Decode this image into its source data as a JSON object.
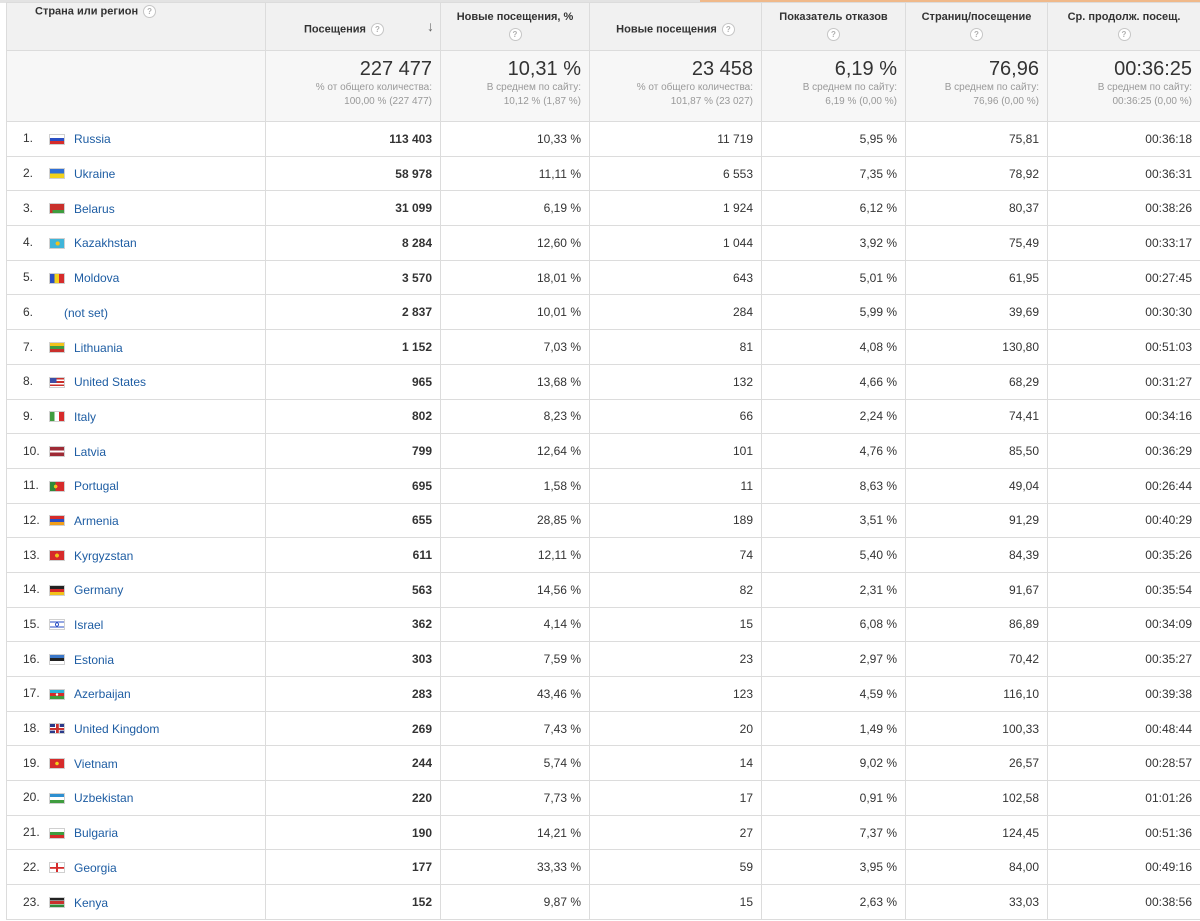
{
  "columns": [
    {
      "label": "Страна или регион",
      "help": "?"
    },
    {
      "label": "Посещения",
      "help": "?",
      "sort": "↓"
    },
    {
      "label": "Новые посещения, %",
      "help": "?"
    },
    {
      "label": "Новые посещения",
      "help": "?"
    },
    {
      "label": "Показатель отказов",
      "help": "?"
    },
    {
      "label": "Страниц/посещение",
      "help": "?"
    },
    {
      "label": "Ср. продолж. посещ.",
      "help": "?"
    }
  ],
  "totals": [
    {
      "value": "227 477",
      "sub1": "% от общего количества:",
      "sub2": "100,00 % (227 477)"
    },
    {
      "value": "10,31 %",
      "sub1": "В среднем по сайту:",
      "sub2": "10,12 % (1,87 %)"
    },
    {
      "value": "23 458",
      "sub1": "% от общего количества:",
      "sub2": "101,87 % (23 027)"
    },
    {
      "value": "6,19 %",
      "sub1": "В среднем по сайту:",
      "sub2": "6,19 % (0,00 %)"
    },
    {
      "value": "76,96",
      "sub1": "В среднем по сайту:",
      "sub2": "76,96 (0,00 %)"
    },
    {
      "value": "00:36:25",
      "sub1": "В среднем по сайту:",
      "sub2": "00:36:25 (0,00 %)"
    }
  ],
  "rows": [
    {
      "rank": "1.",
      "country": "Russia",
      "flag": "russia-flag-icon",
      "visits": "113 403",
      "new_pct": "10,33 %",
      "new_visits": "11 719",
      "bounce": "5,95 %",
      "pages": "75,81",
      "duration": "00:36:18"
    },
    {
      "rank": "2.",
      "country": "Ukraine",
      "flag": "ukraine-flag-icon",
      "visits": "58 978",
      "new_pct": "11,11 %",
      "new_visits": "6 553",
      "bounce": "7,35 %",
      "pages": "78,92",
      "duration": "00:36:31"
    },
    {
      "rank": "3.",
      "country": "Belarus",
      "flag": "belarus-flag-icon",
      "visits": "31 099",
      "new_pct": "6,19 %",
      "new_visits": "1 924",
      "bounce": "6,12 %",
      "pages": "80,37",
      "duration": "00:38:26"
    },
    {
      "rank": "4.",
      "country": "Kazakhstan",
      "flag": "kazakhstan-flag-icon",
      "visits": "8 284",
      "new_pct": "12,60 %",
      "new_visits": "1 044",
      "bounce": "3,92 %",
      "pages": "75,49",
      "duration": "00:33:17"
    },
    {
      "rank": "5.",
      "country": "Moldova",
      "flag": "moldova-flag-icon",
      "visits": "3 570",
      "new_pct": "18,01 %",
      "new_visits": "643",
      "bounce": "5,01 %",
      "pages": "61,95",
      "duration": "00:27:45"
    },
    {
      "rank": "6.",
      "country": "(not set)",
      "flag": "",
      "visits": "2 837",
      "new_pct": "10,01 %",
      "new_visits": "284",
      "bounce": "5,99 %",
      "pages": "39,69",
      "duration": "00:30:30"
    },
    {
      "rank": "7.",
      "country": "Lithuania",
      "flag": "lithuania-flag-icon",
      "visits": "1 152",
      "new_pct": "7,03 %",
      "new_visits": "81",
      "bounce": "4,08 %",
      "pages": "130,80",
      "duration": "00:51:03"
    },
    {
      "rank": "8.",
      "country": "United States",
      "flag": "united-states-flag-icon",
      "visits": "965",
      "new_pct": "13,68 %",
      "new_visits": "132",
      "bounce": "4,66 %",
      "pages": "68,29",
      "duration": "00:31:27"
    },
    {
      "rank": "9.",
      "country": "Italy",
      "flag": "italy-flag-icon",
      "visits": "802",
      "new_pct": "8,23 %",
      "new_visits": "66",
      "bounce": "2,24 %",
      "pages": "74,41",
      "duration": "00:34:16"
    },
    {
      "rank": "10.",
      "country": "Latvia",
      "flag": "latvia-flag-icon",
      "visits": "799",
      "new_pct": "12,64 %",
      "new_visits": "101",
      "bounce": "4,76 %",
      "pages": "85,50",
      "duration": "00:36:29"
    },
    {
      "rank": "11.",
      "country": "Portugal",
      "flag": "portugal-flag-icon",
      "visits": "695",
      "new_pct": "1,58 %",
      "new_visits": "11",
      "bounce": "8,63 %",
      "pages": "49,04",
      "duration": "00:26:44"
    },
    {
      "rank": "12.",
      "country": "Armenia",
      "flag": "armenia-flag-icon",
      "visits": "655",
      "new_pct": "28,85 %",
      "new_visits": "189",
      "bounce": "3,51 %",
      "pages": "91,29",
      "duration": "00:40:29"
    },
    {
      "rank": "13.",
      "country": "Kyrgyzstan",
      "flag": "kyrgyzstan-flag-icon",
      "visits": "611",
      "new_pct": "12,11 %",
      "new_visits": "74",
      "bounce": "5,40 %",
      "pages": "84,39",
      "duration": "00:35:26"
    },
    {
      "rank": "14.",
      "country": "Germany",
      "flag": "germany-flag-icon",
      "visits": "563",
      "new_pct": "14,56 %",
      "new_visits": "82",
      "bounce": "2,31 %",
      "pages": "91,67",
      "duration": "00:35:54"
    },
    {
      "rank": "15.",
      "country": "Israel",
      "flag": "israel-flag-icon",
      "visits": "362",
      "new_pct": "4,14 %",
      "new_visits": "15",
      "bounce": "6,08 %",
      "pages": "86,89",
      "duration": "00:34:09"
    },
    {
      "rank": "16.",
      "country": "Estonia",
      "flag": "estonia-flag-icon",
      "visits": "303",
      "new_pct": "7,59 %",
      "new_visits": "23",
      "bounce": "2,97 %",
      "pages": "70,42",
      "duration": "00:35:27"
    },
    {
      "rank": "17.",
      "country": "Azerbaijan",
      "flag": "azerbaijan-flag-icon",
      "visits": "283",
      "new_pct": "43,46 %",
      "new_visits": "123",
      "bounce": "4,59 %",
      "pages": "116,10",
      "duration": "00:39:38"
    },
    {
      "rank": "18.",
      "country": "United Kingdom",
      "flag": "united-kingdom-flag-icon",
      "visits": "269",
      "new_pct": "7,43 %",
      "new_visits": "20",
      "bounce": "1,49 %",
      "pages": "100,33",
      "duration": "00:48:44"
    },
    {
      "rank": "19.",
      "country": "Vietnam",
      "flag": "vietnam-flag-icon",
      "visits": "244",
      "new_pct": "5,74 %",
      "new_visits": "14",
      "bounce": "9,02 %",
      "pages": "26,57",
      "duration": "00:28:57"
    },
    {
      "rank": "20.",
      "country": "Uzbekistan",
      "flag": "uzbekistan-flag-icon",
      "visits": "220",
      "new_pct": "7,73 %",
      "new_visits": "17",
      "bounce": "0,91 %",
      "pages": "102,58",
      "duration": "01:01:26"
    },
    {
      "rank": "21.",
      "country": "Bulgaria",
      "flag": "bulgaria-flag-icon",
      "visits": "190",
      "new_pct": "14,21 %",
      "new_visits": "27",
      "bounce": "7,37 %",
      "pages": "124,45",
      "duration": "00:51:36"
    },
    {
      "rank": "22.",
      "country": "Georgia",
      "flag": "georgia-flag-icon",
      "visits": "177",
      "new_pct": "33,33 %",
      "new_visits": "59",
      "bounce": "3,95 %",
      "pages": "84,00",
      "duration": "00:49:16"
    },
    {
      "rank": "23.",
      "country": "Kenya",
      "flag": "kenya-flag-icon",
      "visits": "152",
      "new_pct": "9,87 %",
      "new_visits": "15",
      "bounce": "2,63 %",
      "pages": "33,03",
      "duration": "00:38:56"
    }
  ],
  "colors": {
    "link": "#1e5da3",
    "header_bg": "#f1f1f1",
    "totals_bg": "#f7f7f7",
    "border": "#dcdcdc",
    "accent_line": "#f0b98a"
  }
}
